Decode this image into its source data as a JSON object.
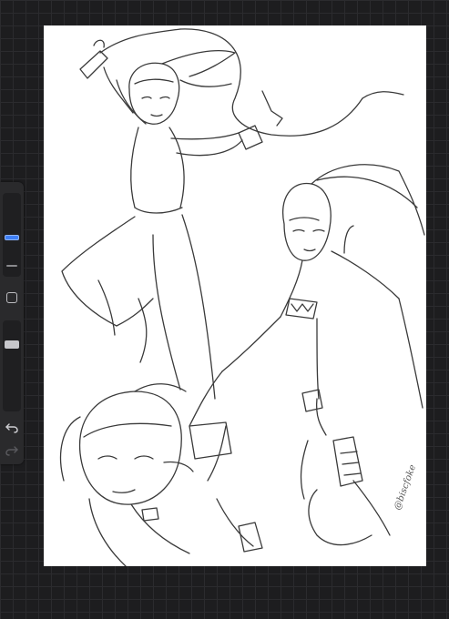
{
  "artwork": {
    "signature": "@biscfoke"
  },
  "sidebar": {
    "brush_size_level": 0.5,
    "brush_opacity_level": 0.92,
    "tools": [
      {
        "icon": "square-modify-icon"
      },
      {
        "icon": "undo-arrow-icon"
      },
      {
        "icon": "redo-arrow-icon",
        "state": "disabled"
      }
    ]
  },
  "colors": {
    "background": "#1d1d1f",
    "canvas": "#ffffff",
    "accent": "#3f7ff6",
    "line": "#3a3a3a"
  }
}
